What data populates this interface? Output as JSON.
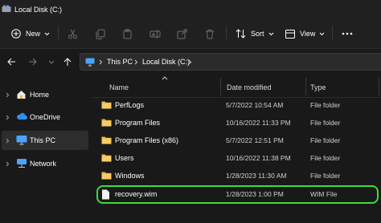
{
  "window": {
    "title": "Local Disk (C:)"
  },
  "toolbar": {
    "new_label": "New",
    "sort_label": "Sort",
    "view_label": "View",
    "icons": [
      "plus-icon",
      "cut-icon",
      "copy-icon",
      "paste-icon",
      "rename-icon",
      "share-icon",
      "delete-icon",
      "sort-icon",
      "view-icon",
      "more-icon"
    ]
  },
  "breadcrumb": [
    "This PC",
    "Local Disk (C:)"
  ],
  "sidebar": {
    "items": [
      {
        "label": "Home",
        "icon": "home-icon"
      },
      {
        "label": "OneDrive",
        "icon": "cloud-icon"
      },
      {
        "label": "This PC",
        "icon": "computer-icon",
        "selected": true
      },
      {
        "label": "Network",
        "icon": "network-icon"
      }
    ]
  },
  "table": {
    "columns": [
      "Name",
      "Date modified",
      "Type"
    ],
    "rows": [
      {
        "name": "PerfLogs",
        "date": "5/7/2022 10:54 AM",
        "type": "File folder",
        "kind": "folder"
      },
      {
        "name": "Program Files",
        "date": "10/16/2022 11:33 PM",
        "type": "File folder",
        "kind": "folder"
      },
      {
        "name": "Program Files (x86)",
        "date": "5/7/2022 12:51 PM",
        "type": "File folder",
        "kind": "folder"
      },
      {
        "name": "Users",
        "date": "10/16/2022 11:38 PM",
        "type": "File folder",
        "kind": "folder"
      },
      {
        "name": "Windows",
        "date": "1/28/2023 11:30 AM",
        "type": "File folder",
        "kind": "folder"
      },
      {
        "name": "recovery.wim",
        "date": "1/28/2023 1:00 PM",
        "type": "WIM File",
        "kind": "file",
        "highlighted": true
      }
    ]
  },
  "colors": {
    "background": "#191919",
    "chrome": "#202020",
    "folder": "#e8b84a",
    "highlight": "#3ddc3d"
  }
}
